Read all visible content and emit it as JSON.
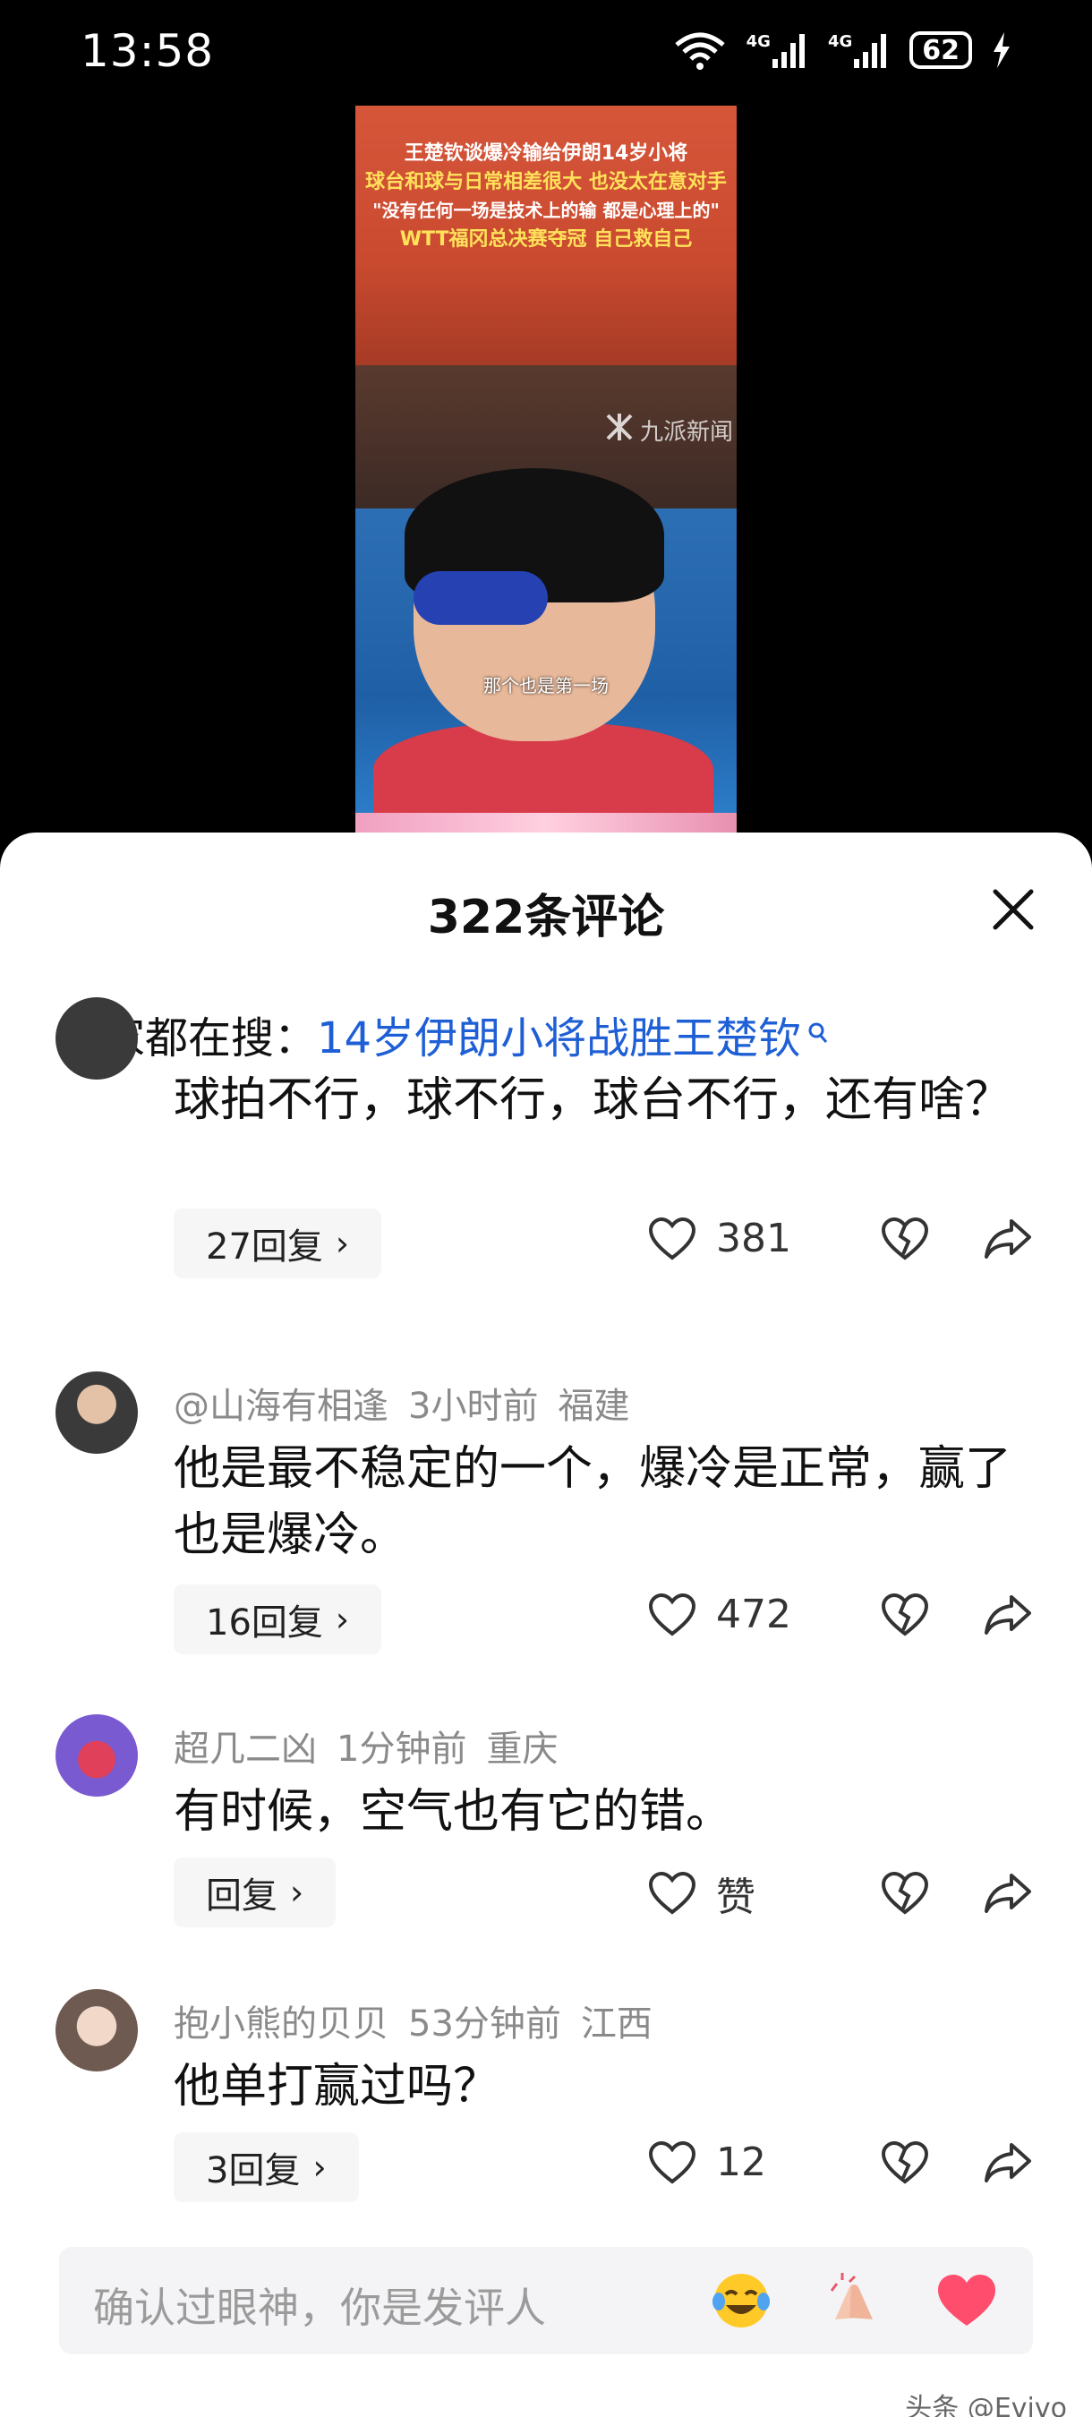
{
  "status_bar": {
    "time": "13:58",
    "signal_1": "4G",
    "signal_2": "4G",
    "battery": "62",
    "wifi_label": "6"
  },
  "video": {
    "caption_lines": [
      "王楚钦谈爆冷输给伊朗14岁小将",
      "球台和球与日常相差很大 也没太在意对手",
      "\"没有任何一场是技术上的输 都是心理上的\"",
      "WTT福冈总决赛夺冠 自己救自己"
    ],
    "subtitle": "那个也是第一场",
    "watermark": "九派新闻"
  },
  "sheet": {
    "title": "322条评论",
    "search_prefix": "大家都在搜：",
    "search_link": "14岁伊朗小将战胜王楚钦"
  },
  "comments": [
    {
      "text": "球拍不行，球不行，球台不行，还有啥？",
      "reply": "27回复",
      "likes": "381"
    },
    {
      "user": "@山海有相逢",
      "time": "3小时前",
      "location": "福建",
      "text": "他是最不稳定的一个，爆冷是正常，赢了也是爆冷。",
      "reply": "16回复",
      "likes": "472"
    },
    {
      "user": "超几二凶",
      "time": "1分钟前",
      "location": "重庆",
      "text": "有时候，空气也有它的错。",
      "reply": "回复",
      "likes": "赞"
    },
    {
      "user": "抱小熊的贝贝",
      "time": "53分钟前",
      "location": "江西",
      "text": "他单打赢过吗？",
      "reply": "3回复",
      "likes": "12"
    }
  ],
  "input": {
    "placeholder": "确认过眼神，你是发评人"
  },
  "emojis": [
    "laughing-crying-emoji",
    "clapping-hands-emoji",
    "red-heart-emoji"
  ],
  "footer": {
    "watermark": "头条 @Evivo"
  },
  "colors": {
    "link": "#1f5fd6",
    "heart": "#ff4d6d"
  }
}
